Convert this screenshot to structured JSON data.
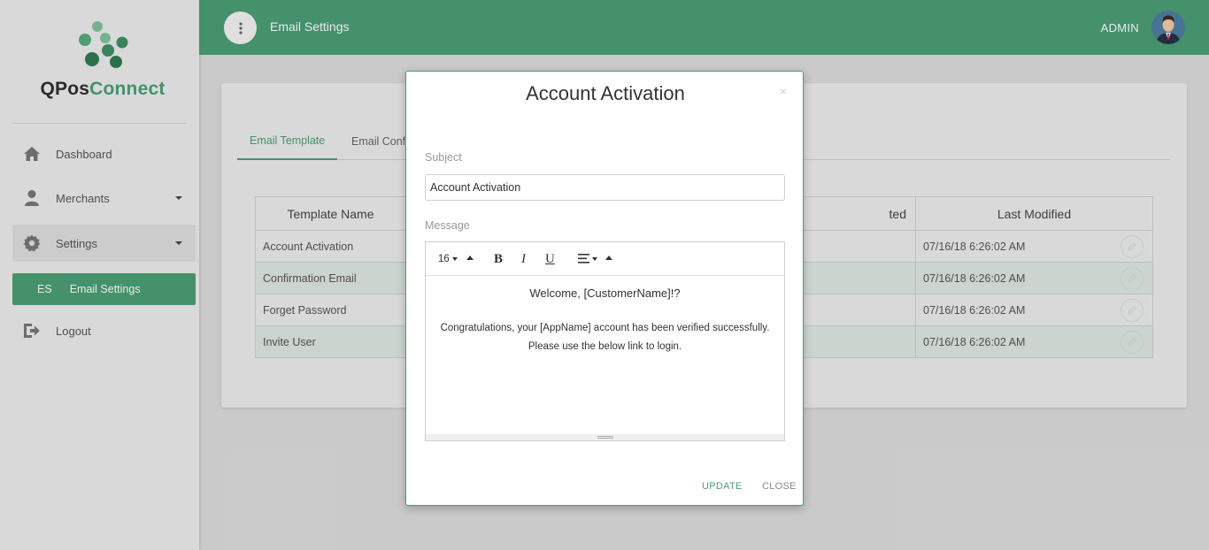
{
  "brand": {
    "part1": "QPos",
    "part2": "Connect"
  },
  "sidebar": {
    "items": [
      {
        "label": "Dashboard",
        "icon": "home-icon"
      },
      {
        "label": "Merchants",
        "icon": "user-icon"
      },
      {
        "label": "Settings",
        "icon": "gear-icon"
      },
      {
        "label": "Logout",
        "icon": "logout-icon"
      }
    ],
    "sub_item": {
      "abbr": "ES",
      "label": "Email Settings"
    }
  },
  "header": {
    "title": "Email Settings",
    "user": "ADMIN"
  },
  "tabs": [
    {
      "label": "Email Template"
    },
    {
      "label": "Email Conf"
    }
  ],
  "table": {
    "headers": [
      "Template Name",
      "ted",
      "Last Modified"
    ],
    "rows": [
      {
        "name": "Account Activation",
        "modified": "07/16/18 6:26:02 AM"
      },
      {
        "name": "Confirmation Email",
        "modified": "07/16/18 6:26:02 AM"
      },
      {
        "name": "Forget Password",
        "modified": "07/16/18 6:26:02 AM"
      },
      {
        "name": "Invite User",
        "modified": "07/16/18 6:26:02 AM"
      }
    ]
  },
  "modal": {
    "title": "Account Activation",
    "close_x": "×",
    "subject_label": "Subject",
    "subject_value": "Account Activation",
    "message_label": "Message",
    "toolbar": {
      "font_size": "16",
      "bold": "B",
      "italic": "I",
      "underline": "U"
    },
    "message_line1": "Welcome, [CustomerName]!?",
    "message_line2": "Congratulations, your [AppName] account has been verified successfully.",
    "message_line3": "Please use the below link to login.",
    "update_label": "UPDATE",
    "close_label": "CLOSE"
  },
  "colors": {
    "accent": "#4a9e75",
    "sidebar_bg": "#ececec",
    "row_alt": "#dde7e1"
  }
}
